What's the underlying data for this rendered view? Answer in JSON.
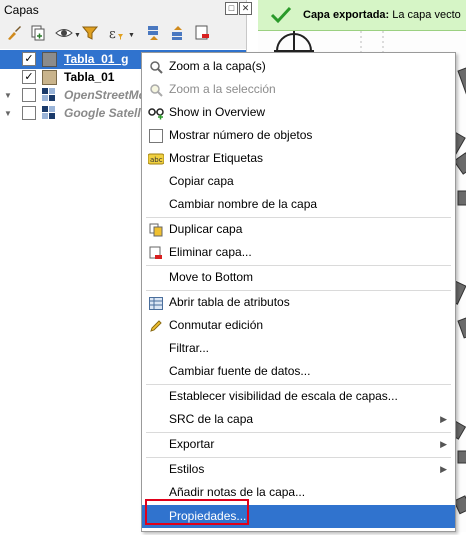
{
  "panel": {
    "title": "Capas",
    "window_buttons": [
      "float-icon",
      "close-icon"
    ],
    "toolbar": [
      "style-brush-icon",
      "add-group-icon",
      "eye-icon",
      "filter-icon",
      "expression-filter-icon",
      "expand-all-icon",
      "collapse-all-icon",
      "remove-layer-icon"
    ]
  },
  "layers": [
    {
      "name": "Tabla_01_g",
      "checked": true,
      "selected": true,
      "symbol_color": "#8c8c8c"
    },
    {
      "name": "Tabla_01",
      "checked": true,
      "selected": false,
      "symbol_color": "#c9b48c"
    },
    {
      "name": "OpenStreetMo",
      "checked": false,
      "selected": false,
      "grayed": true
    },
    {
      "name": "Google Satell",
      "checked": false,
      "selected": false,
      "grayed": true
    }
  ],
  "message": {
    "title": "Capa exportada:",
    "text": "La capa vecto",
    "color": "#d6f5c6"
  },
  "menu": {
    "items": [
      {
        "label": "Zoom a la capa(s)",
        "icon": "zoom-icon"
      },
      {
        "label": "Zoom a la selección",
        "icon": "zoom-selection-icon",
        "disabled": true
      },
      {
        "label": "Show in Overview",
        "icon": "overview-icon"
      },
      {
        "label": "Mostrar número de objetos",
        "icon": "checkbox-icon"
      },
      {
        "label": "Mostrar Etiquetas",
        "icon": "labels-icon"
      },
      {
        "label": "Copiar capa"
      },
      {
        "label": "Cambiar nombre de la capa"
      },
      {
        "label": "Duplicar capa",
        "icon": "duplicate-icon"
      },
      {
        "label": "Eliminar capa...",
        "icon": "remove-icon"
      },
      {
        "label": "Move to Bottom"
      },
      {
        "label": "Abrir tabla de atributos",
        "icon": "table-icon"
      },
      {
        "label": "Conmutar edición",
        "icon": "pencil-icon"
      },
      {
        "label": "Filtrar..."
      },
      {
        "label": "Cambiar fuente de datos..."
      },
      {
        "label": "Establecer visibilidad de escala de capas..."
      },
      {
        "label": "SRC de la capa",
        "submenu": true
      },
      {
        "label": "Exportar",
        "submenu": true
      },
      {
        "label": "Estilos",
        "submenu": true
      },
      {
        "label": "Añadir notas de la capa..."
      },
      {
        "label": "Propiedades...",
        "highlighted": true
      }
    ],
    "highlight_color": "#3073ce",
    "annotation_color": "#e0001a"
  }
}
